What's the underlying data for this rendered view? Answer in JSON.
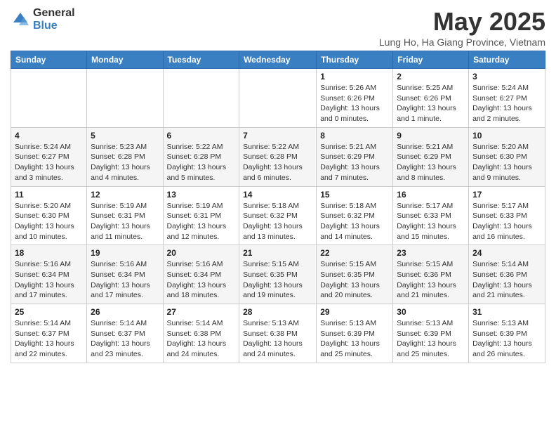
{
  "logo": {
    "general": "General",
    "blue": "Blue"
  },
  "title": "May 2025",
  "subtitle": "Lung Ho, Ha Giang Province, Vietnam",
  "weekdays": [
    "Sunday",
    "Monday",
    "Tuesday",
    "Wednesday",
    "Thursday",
    "Friday",
    "Saturday"
  ],
  "weeks": [
    [
      {
        "day": "",
        "info": ""
      },
      {
        "day": "",
        "info": ""
      },
      {
        "day": "",
        "info": ""
      },
      {
        "day": "",
        "info": ""
      },
      {
        "day": "1",
        "info": "Sunrise: 5:26 AM\nSunset: 6:26 PM\nDaylight: 13 hours\nand 0 minutes."
      },
      {
        "day": "2",
        "info": "Sunrise: 5:25 AM\nSunset: 6:26 PM\nDaylight: 13 hours\nand 1 minute."
      },
      {
        "day": "3",
        "info": "Sunrise: 5:24 AM\nSunset: 6:27 PM\nDaylight: 13 hours\nand 2 minutes."
      }
    ],
    [
      {
        "day": "4",
        "info": "Sunrise: 5:24 AM\nSunset: 6:27 PM\nDaylight: 13 hours\nand 3 minutes."
      },
      {
        "day": "5",
        "info": "Sunrise: 5:23 AM\nSunset: 6:28 PM\nDaylight: 13 hours\nand 4 minutes."
      },
      {
        "day": "6",
        "info": "Sunrise: 5:22 AM\nSunset: 6:28 PM\nDaylight: 13 hours\nand 5 minutes."
      },
      {
        "day": "7",
        "info": "Sunrise: 5:22 AM\nSunset: 6:28 PM\nDaylight: 13 hours\nand 6 minutes."
      },
      {
        "day": "8",
        "info": "Sunrise: 5:21 AM\nSunset: 6:29 PM\nDaylight: 13 hours\nand 7 minutes."
      },
      {
        "day": "9",
        "info": "Sunrise: 5:21 AM\nSunset: 6:29 PM\nDaylight: 13 hours\nand 8 minutes."
      },
      {
        "day": "10",
        "info": "Sunrise: 5:20 AM\nSunset: 6:30 PM\nDaylight: 13 hours\nand 9 minutes."
      }
    ],
    [
      {
        "day": "11",
        "info": "Sunrise: 5:20 AM\nSunset: 6:30 PM\nDaylight: 13 hours\nand 10 minutes."
      },
      {
        "day": "12",
        "info": "Sunrise: 5:19 AM\nSunset: 6:31 PM\nDaylight: 13 hours\nand 11 minutes."
      },
      {
        "day": "13",
        "info": "Sunrise: 5:19 AM\nSunset: 6:31 PM\nDaylight: 13 hours\nand 12 minutes."
      },
      {
        "day": "14",
        "info": "Sunrise: 5:18 AM\nSunset: 6:32 PM\nDaylight: 13 hours\nand 13 minutes."
      },
      {
        "day": "15",
        "info": "Sunrise: 5:18 AM\nSunset: 6:32 PM\nDaylight: 13 hours\nand 14 minutes."
      },
      {
        "day": "16",
        "info": "Sunrise: 5:17 AM\nSunset: 6:33 PM\nDaylight: 13 hours\nand 15 minutes."
      },
      {
        "day": "17",
        "info": "Sunrise: 5:17 AM\nSunset: 6:33 PM\nDaylight: 13 hours\nand 16 minutes."
      }
    ],
    [
      {
        "day": "18",
        "info": "Sunrise: 5:16 AM\nSunset: 6:34 PM\nDaylight: 13 hours\nand 17 minutes."
      },
      {
        "day": "19",
        "info": "Sunrise: 5:16 AM\nSunset: 6:34 PM\nDaylight: 13 hours\nand 17 minutes."
      },
      {
        "day": "20",
        "info": "Sunrise: 5:16 AM\nSunset: 6:34 PM\nDaylight: 13 hours\nand 18 minutes."
      },
      {
        "day": "21",
        "info": "Sunrise: 5:15 AM\nSunset: 6:35 PM\nDaylight: 13 hours\nand 19 minutes."
      },
      {
        "day": "22",
        "info": "Sunrise: 5:15 AM\nSunset: 6:35 PM\nDaylight: 13 hours\nand 20 minutes."
      },
      {
        "day": "23",
        "info": "Sunrise: 5:15 AM\nSunset: 6:36 PM\nDaylight: 13 hours\nand 21 minutes."
      },
      {
        "day": "24",
        "info": "Sunrise: 5:14 AM\nSunset: 6:36 PM\nDaylight: 13 hours\nand 21 minutes."
      }
    ],
    [
      {
        "day": "25",
        "info": "Sunrise: 5:14 AM\nSunset: 6:37 PM\nDaylight: 13 hours\nand 22 minutes."
      },
      {
        "day": "26",
        "info": "Sunrise: 5:14 AM\nSunset: 6:37 PM\nDaylight: 13 hours\nand 23 minutes."
      },
      {
        "day": "27",
        "info": "Sunrise: 5:14 AM\nSunset: 6:38 PM\nDaylight: 13 hours\nand 24 minutes."
      },
      {
        "day": "28",
        "info": "Sunrise: 5:13 AM\nSunset: 6:38 PM\nDaylight: 13 hours\nand 24 minutes."
      },
      {
        "day": "29",
        "info": "Sunrise: 5:13 AM\nSunset: 6:39 PM\nDaylight: 13 hours\nand 25 minutes."
      },
      {
        "day": "30",
        "info": "Sunrise: 5:13 AM\nSunset: 6:39 PM\nDaylight: 13 hours\nand 25 minutes."
      },
      {
        "day": "31",
        "info": "Sunrise: 5:13 AM\nSunset: 6:39 PM\nDaylight: 13 hours\nand 26 minutes."
      }
    ]
  ]
}
